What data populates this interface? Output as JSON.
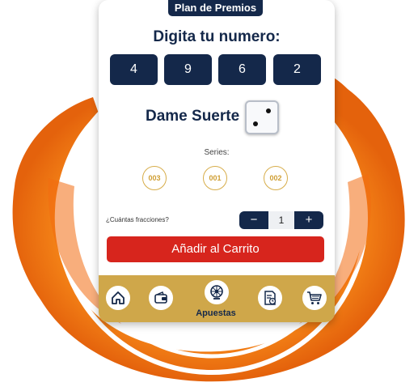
{
  "header": {
    "plan_tab": "Plan de Premios",
    "title": "Digita tu numero:"
  },
  "number": {
    "digits": [
      "4",
      "9",
      "6",
      "2"
    ]
  },
  "luck": {
    "label": "Dame Suerte",
    "icon": "dice-icon"
  },
  "series": {
    "label": "Series:",
    "chips": [
      "003",
      "001",
      "002"
    ]
  },
  "fractions": {
    "label": "¿Cuántas fracciones?",
    "minus": "−",
    "value": "1",
    "plus": "+"
  },
  "cart": {
    "button_label": "Añadir al Carrito"
  },
  "nav": {
    "items": [
      {
        "icon": "home-icon"
      },
      {
        "icon": "wallet-icon"
      },
      {
        "icon": "lottery-wheel-icon",
        "label": "Apuestas",
        "active": true
      },
      {
        "icon": "receipt-clock-icon"
      },
      {
        "icon": "shopping-cart-icon"
      }
    ]
  },
  "colors": {
    "navy": "#14284a",
    "gold": "#cfa74a",
    "red": "#d7251d",
    "splash": "#f08a14"
  }
}
